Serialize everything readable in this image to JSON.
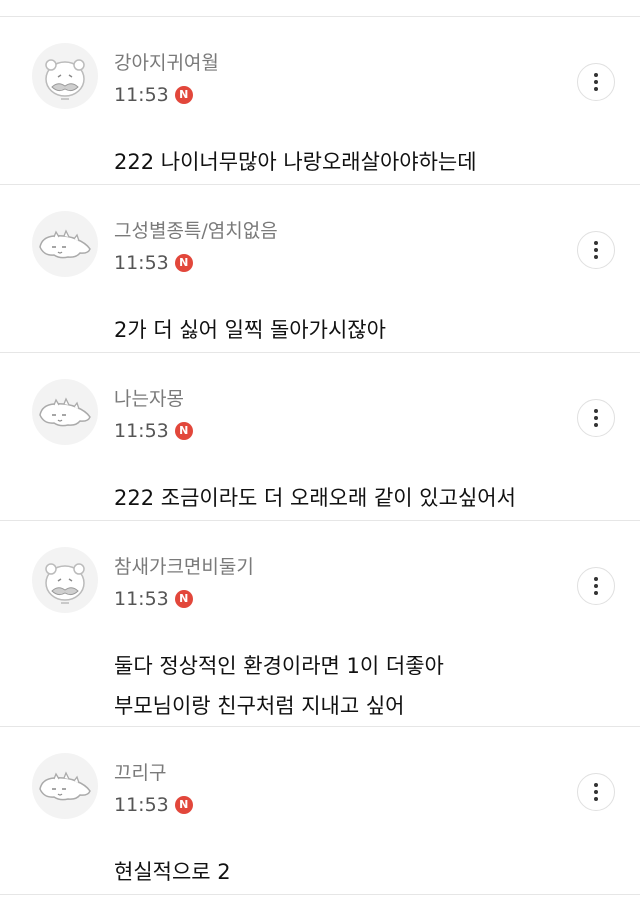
{
  "comments": [
    {
      "author": "강아지귀여월",
      "time": "11:53",
      "badge": "N",
      "lines": [
        "222 나이너무많아 나랑오래살아야하는데"
      ],
      "avatar_icon": "mustache-bear-icon"
    },
    {
      "author": "그성별종특/염치없음",
      "time": "11:53",
      "badge": "N",
      "lines": [
        "2가 더 싫어 일찍 돌아가시잖아"
      ],
      "avatar_icon": "lizard-icon"
    },
    {
      "author": "나는자몽",
      "time": "11:53",
      "badge": "N",
      "lines": [
        "222 조금이라도 더 오래오래 같이 있고싶어서"
      ],
      "avatar_icon": "lizard-icon"
    },
    {
      "author": "참새가크면비둘기",
      "time": "11:53",
      "badge": "N",
      "lines": [
        "둘다 정상적인 환경이라면 1이 더좋아",
        "부모님이랑 친구처럼 지내고 싶어"
      ],
      "avatar_icon": "mustache-bear-icon"
    },
    {
      "author": "끄리구",
      "time": "11:53",
      "badge": "N",
      "lines": [
        "현실적으로 2"
      ],
      "avatar_icon": "lizard-icon"
    }
  ],
  "more_icon": "vertical-ellipsis-icon",
  "colors": {
    "badge": "#e2473b",
    "author": "#7a7a7a",
    "divider": "#e6e6e6"
  }
}
